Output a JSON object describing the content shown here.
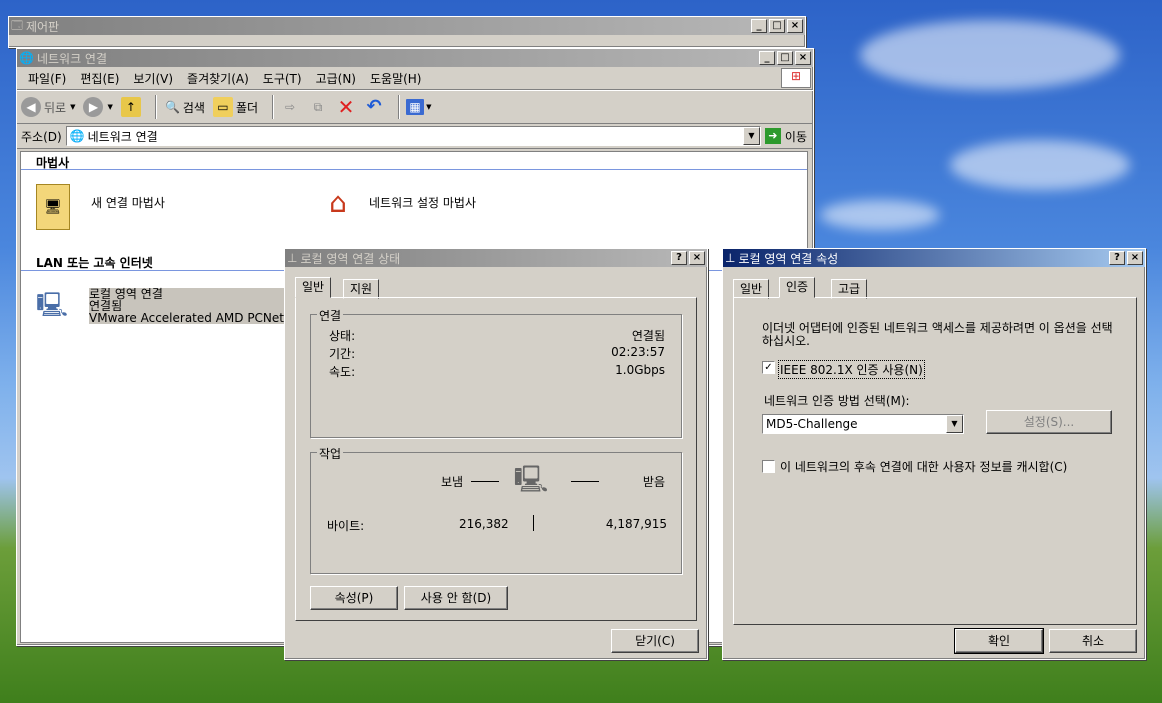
{
  "control_panel": {
    "title": "제어판"
  },
  "netconn": {
    "title": "네트워크 연결",
    "menu": [
      "파일(F)",
      "편집(E)",
      "보기(V)",
      "즐겨찾기(A)",
      "도구(T)",
      "고급(N)",
      "도움말(H)"
    ],
    "toolbar": {
      "back": "뒤로",
      "search": "검색",
      "folders": "폴더"
    },
    "address_label": "주소(D)",
    "address_value": "네트워크 연결",
    "go_label": "이동",
    "wizard_header": "마법사",
    "wizard_new": "새 연결 마법사",
    "wizard_network": "네트워크 설정 마법사",
    "lan_header": "LAN 또는 고속 인터넷",
    "lan_item": {
      "name": "로컬 영역 연결",
      "status": "연결됨",
      "device": "VMware Accelerated AMD PCNet"
    }
  },
  "status_dialog": {
    "title": "로컬 영역 연결 상태",
    "tabs": [
      "일반",
      "지원"
    ],
    "connection_group": "연결",
    "rows": [
      {
        "label": "상태:",
        "value": "연결됨"
      },
      {
        "label": "기간:",
        "value": "02:23:57"
      },
      {
        "label": "속도:",
        "value": "1.0Gbps"
      }
    ],
    "activity_group": "작업",
    "sent_label": "보냄",
    "received_label": "받음",
    "bytes_label": "바이트:",
    "bytes_sent": "216,382",
    "bytes_received": "4,187,915",
    "properties_button": "속성(P)",
    "disable_button": "사용 안 함(D)",
    "close_button": "닫기(C)"
  },
  "props_dialog": {
    "title": "로컬 영역 연결 속성",
    "tabs": [
      "일반",
      "인증",
      "고급"
    ],
    "description": "이더넷 어댑터에 인증된 네트워크 액세스를 제공하려면 이 옵션을 선택하십시오.",
    "enable_8021x": "IEEE 802.1X 인증 사용(N)",
    "method_label": "네트워크 인증 방법 선택(M):",
    "method_value": "MD5-Challenge",
    "settings_button": "설정(S)...",
    "cache_label": "이 네트워크의 후속 연결에 대한 사용자 정보를 캐시합(C)",
    "ok_button": "확인",
    "cancel_button": "취소"
  }
}
